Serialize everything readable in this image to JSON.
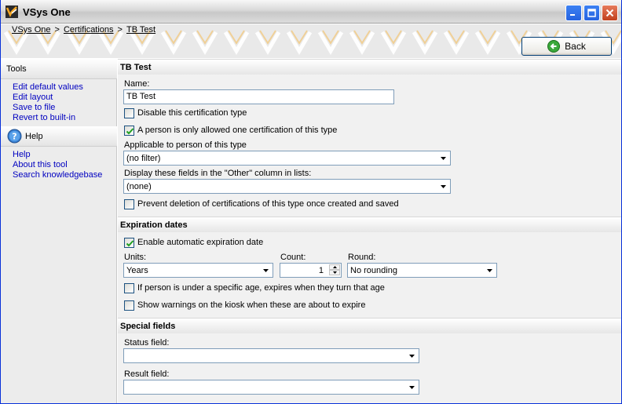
{
  "window": {
    "title": "VSys One"
  },
  "breadcrumb": {
    "items": [
      "VSys One",
      "Certifications",
      "TB Test"
    ],
    "separator": ">"
  },
  "back_button": {
    "label": "Back"
  },
  "left_panel": {
    "tools": {
      "heading": "Tools",
      "links": [
        "Edit default values",
        "Edit layout",
        "Save to file",
        "Revert to built-in"
      ]
    },
    "help": {
      "heading": "Help",
      "links": [
        "Help",
        "About this tool",
        "Search knowledgebase"
      ]
    }
  },
  "main": {
    "general": {
      "heading": "TB Test",
      "name_label": "Name:",
      "name_value": "TB Test",
      "disable_label": "Disable this certification type",
      "disable_checked": false,
      "one_cert_label": "A person is only allowed one certification of this type",
      "one_cert_checked": true,
      "applicable_label": "Applicable to person of this type",
      "applicable_value": "(no filter)",
      "display_fields_label": "Display these fields in the \"Other\" column in lists:",
      "display_fields_value": "(none)",
      "prevent_delete_label": "Prevent deletion of certifications of this type once created and saved",
      "prevent_delete_checked": false
    },
    "expiration": {
      "heading": "Expiration dates",
      "enable_label": "Enable automatic expiration date",
      "enable_checked": true,
      "units_label": "Units:",
      "units_value": "Years",
      "count_label": "Count:",
      "count_value": "1",
      "round_label": "Round:",
      "round_value": "No rounding",
      "age_label": "If person is under a specific age, expires when they turn that age",
      "age_checked": false,
      "kiosk_label": "Show warnings on the kiosk when these are about to expire",
      "kiosk_checked": false
    },
    "special": {
      "heading": "Special fields",
      "status_label": "Status field:",
      "status_value": "",
      "result_label": "Result field:",
      "result_value": ""
    }
  },
  "colors": {
    "link": "#0000c0",
    "accent_orange": "#f5a623",
    "titlebar_close": "#c1411e",
    "titlebar_button": "#2663e0"
  }
}
